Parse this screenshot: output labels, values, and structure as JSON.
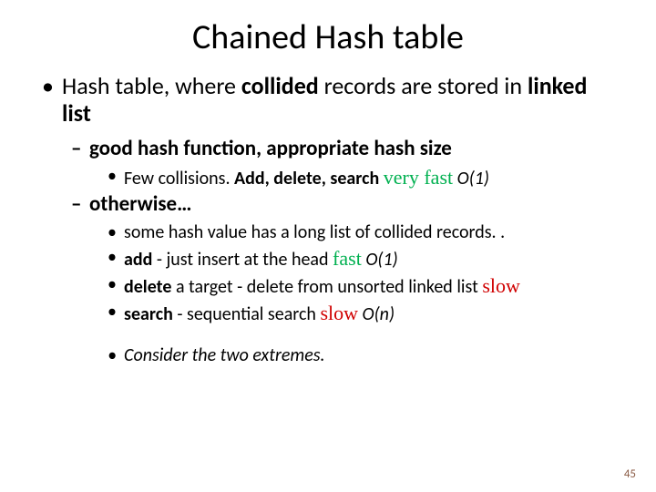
{
  "title": "Chained Hash table",
  "bullet1_a": "Hash table, where ",
  "bullet1_b": "collided",
  "bullet1_c": " records are stored in ",
  "bullet1_d": "linked list",
  "sub1": "good hash function, appropriate hash size",
  "sub1_1_a": "Few collisions. ",
  "sub1_1_b": "Add, delete, search ",
  "sub1_1_c": "very fast",
  "sub1_1_d": " O(1)",
  "sub2": "otherwise…",
  "sub2_1": "some hash value has a long list of collided records. .",
  "sub2_2_a": "add ",
  "sub2_2_b": "- just insert at the head ",
  "sub2_2_c": "fast",
  "sub2_2_d": " O(1)",
  "sub2_3_a": "delete ",
  "sub2_3_b": "a target - delete from unsorted linked list ",
  "sub2_3_c": "slow",
  "sub2_4_a": "search ",
  "sub2_4_b": "- sequential search ",
  "sub2_4_c": "slow",
  "sub2_4_d": " O(n)",
  "sub3": "Consider the two extremes.",
  "page": "45"
}
